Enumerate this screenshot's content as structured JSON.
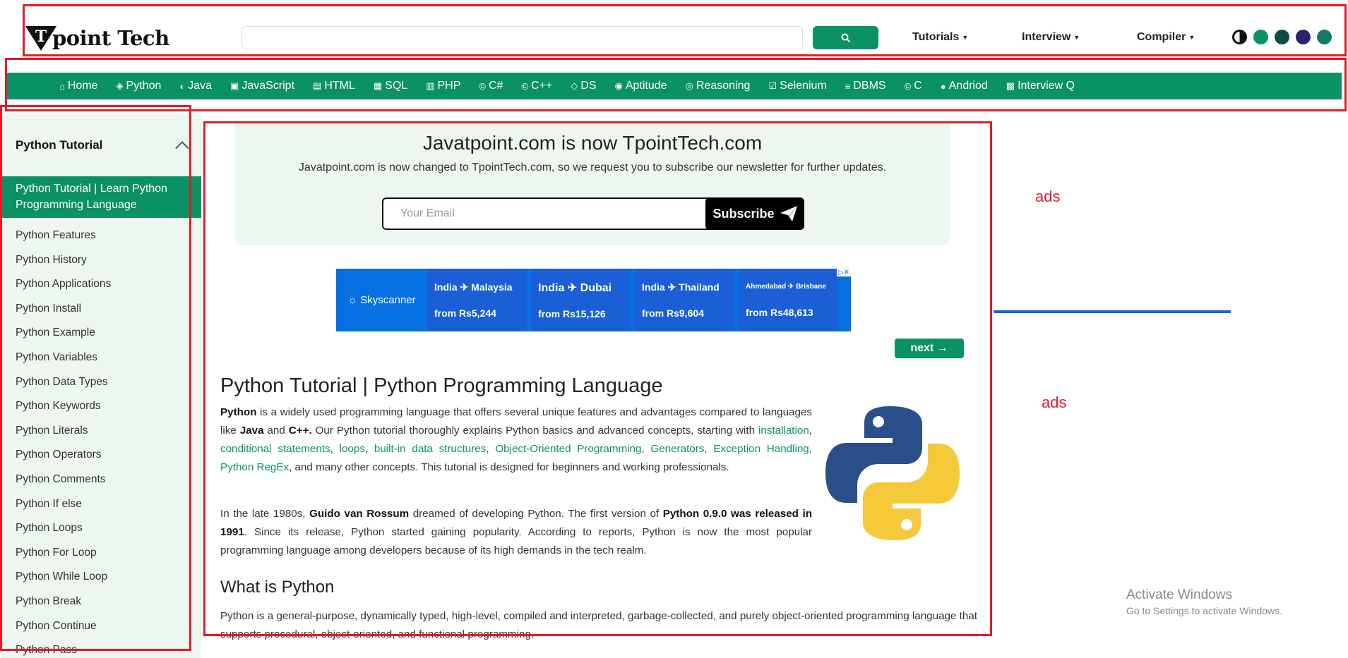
{
  "header": {
    "logo_text": "point Tech",
    "logo_letter": "T",
    "search_placeholder": "",
    "nav": [
      "Tutorials",
      "Interview",
      "Compiler"
    ],
    "theme_colors": [
      "#0a9164",
      "#0b4d4a",
      "#2a2470",
      "#137a6b"
    ]
  },
  "menu": [
    {
      "label": "Home",
      "icon": "home-icon"
    },
    {
      "label": "Python",
      "icon": "python-icon"
    },
    {
      "label": "Java",
      "icon": "java-icon"
    },
    {
      "label": "JavaScript",
      "icon": "javascript-icon"
    },
    {
      "label": "HTML",
      "icon": "html-icon"
    },
    {
      "label": "SQL",
      "icon": "sql-icon"
    },
    {
      "label": "PHP",
      "icon": "php-icon"
    },
    {
      "label": "C#",
      "icon": "csharp-icon"
    },
    {
      "label": "C++",
      "icon": "cpp-icon"
    },
    {
      "label": "DS",
      "icon": "ds-icon"
    },
    {
      "label": "Aptitude",
      "icon": "aptitude-icon"
    },
    {
      "label": "Reasoning",
      "icon": "reasoning-icon"
    },
    {
      "label": "Selenium",
      "icon": "selenium-icon"
    },
    {
      "label": "DBMS",
      "icon": "dbms-icon"
    },
    {
      "label": "C",
      "icon": "c-icon"
    },
    {
      "label": "Andriod",
      "icon": "android-icon"
    },
    {
      "label": "Interview Q",
      "icon": "interview-icon"
    }
  ],
  "sidebar": {
    "title": "Python Tutorial",
    "active": "Python Tutorial | Learn Python Programming Language",
    "items": [
      "Python Features",
      "Python History",
      "Python Applications",
      "Python Install",
      "Python Example",
      "Python Variables",
      "Python Data Types",
      "Python Keywords",
      "Python Literals",
      "Python Operators",
      "Python Comments",
      "Python If else",
      "Python Loops",
      "Python For Loop",
      "Python While Loop",
      "Python Break",
      "Python Continue",
      "Python Pass"
    ]
  },
  "newsletter": {
    "title": "Javatpoint.com is now TpointTech.com",
    "subtitle": "Javatpoint.com is now changed to TpointTech.com, so we request you to subscribe our newsletter for further updates.",
    "email_placeholder": "Your Email",
    "button": "Subscribe"
  },
  "ad": {
    "brand": "Skyscanner",
    "deals": [
      {
        "route": "India ✈ Malaysia",
        "price": "from Rs5,244"
      },
      {
        "route": "India ✈ Dubai",
        "price": "from Rs15,126"
      },
      {
        "route": "India ✈ Thailand",
        "price": "from Rs9,604"
      },
      {
        "route": "Ahmedabad ✈ Brisbane",
        "price": "from Rs48,613"
      }
    ]
  },
  "next_label": "next →",
  "article": {
    "title": "Python Tutorial | Python Programming Language",
    "p1": {
      "b1": "Python",
      "t1": " is a widely used programming language that offers several unique features and advantages compared to languages like ",
      "b2": "Java",
      "t2": " and ",
      "b3": "C++.",
      "t3": " Our Python tutorial thoroughly explains Python basics and advanced concepts, starting with ",
      "links": [
        "installation",
        "conditional statements",
        "loops",
        "built-in data structures",
        "Object-Oriented Programming",
        "Generators",
        "Exception Handling",
        "Python RegEx"
      ],
      "t4": ", and many other concepts. This tutorial is designed for beginners and working professionals."
    },
    "p2": {
      "t1": "In the late 1980s, ",
      "link": "Guido van Rossum",
      "t2": " dreamed of developing Python. The first version of ",
      "b1": "Python 0.9.0 was released in 1991",
      "t3": ". Since its release, Python started gaining popularity. According to reports, Python is now the most popular programming language among developers because of its high demands in the tech realm."
    },
    "h2": "What is Python",
    "p3": "Python is a general-purpose, dynamically typed, high-level, compiled and interpreted, garbage-collected, and purely object-oriented programming language that supports procedural, object-oriented, and functional programming."
  },
  "right": {
    "ads_label_1": "ads",
    "ads_label_2": "ads",
    "watermark_1": "Activate Windows",
    "watermark_2": "Go to Settings to activate Windows."
  }
}
